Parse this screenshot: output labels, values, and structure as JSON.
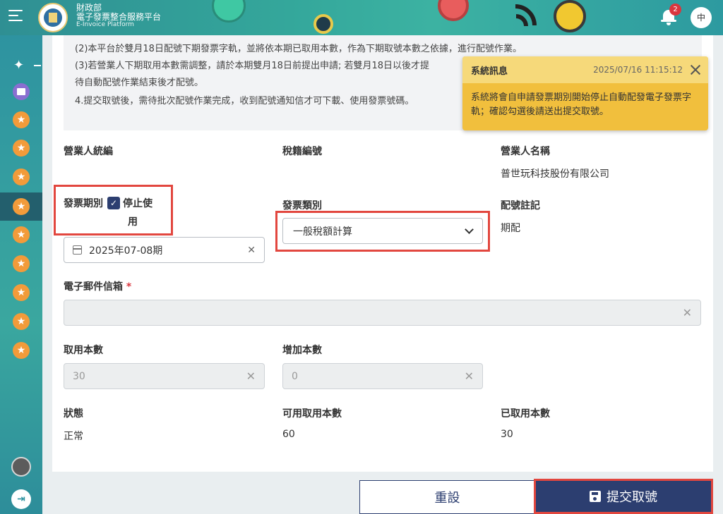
{
  "header": {
    "ministry": "財政部",
    "platform": "電子發票整合服務平台",
    "platform_en": "E-Invoice Platform",
    "notification_count": "2",
    "language": "中"
  },
  "sidebar": {
    "icons": [
      "magic-wand-icon",
      "map-icon",
      "star-icon",
      "star-icon",
      "star-icon",
      "star-icon",
      "star-icon",
      "star-icon",
      "star-icon",
      "star-icon",
      "star-icon"
    ]
  },
  "notice": {
    "line2": "(2)本平台於雙月18日配號下期發票字軌，並將依本期已取用本數，作為下期取號本數之依據，進行配號作業。",
    "line3a": "(3)若營業人下期取用本數需調整，請於本期雙月18日前提出申請; 若雙月18日以後才提",
    "line3b": "待自動配號作業結束後才配號。",
    "line4": "4.提交取號後，需待批次配號作業完成，收到配號通知信才可下載、使用發票號碼。"
  },
  "form": {
    "business_id_label": "營業人統編",
    "tax_id_label": "稅籍編號",
    "business_name_label": "營業人名稱",
    "business_name_value": "普世玩科技股份有限公司",
    "period_label": "發票期別",
    "stop_use_label": "停止使",
    "stop_use_label2": "用",
    "stop_use_checked": true,
    "period_value": "2025年07-08期",
    "invoice_type_label": "發票類別",
    "invoice_type_value": "一般稅額計算",
    "assign_note_label": "配號註記",
    "assign_note_value": "期配",
    "email_label": "電子郵件信箱",
    "email_required": "*",
    "email_value": "",
    "take_count_label": "取用本數",
    "take_count_value": "30",
    "add_count_label": "增加本數",
    "add_count_value": "0",
    "status_label": "狀態",
    "status_value": "正常",
    "available_label": "可用取用本數",
    "available_value": "60",
    "taken_label": "已取用本數",
    "taken_value": "30"
  },
  "buttons": {
    "reset": "重設",
    "submit": "提交取號"
  },
  "toast": {
    "title": "系統訊息",
    "time": "2025/07/16 11:15:12",
    "message": "系統將會自申請發票期別開始停止自動配發電子發票字軌；確認勾選後請送出提交取號。"
  },
  "colors": {
    "header_teal": "#34a79b",
    "primary_navy": "#2c3e70",
    "highlight_red": "#e2473f",
    "toast_yellow": "#f1bf3d",
    "sidebar_star": "#f29b3a"
  }
}
